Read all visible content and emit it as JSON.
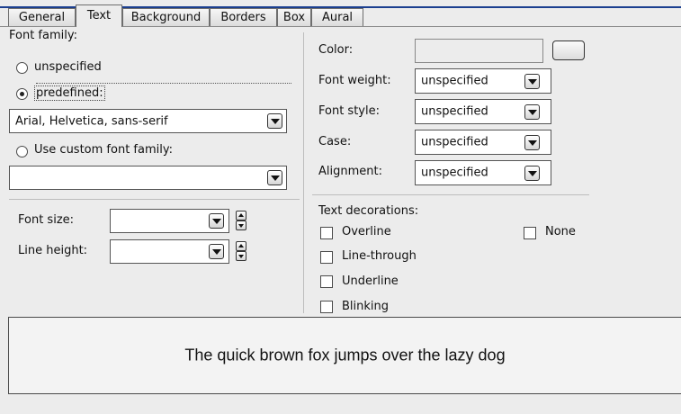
{
  "tabs": [
    {
      "label": "General"
    },
    {
      "label": "Text"
    },
    {
      "label": "Background"
    },
    {
      "label": "Borders"
    },
    {
      "label": "Box"
    },
    {
      "label": "Aural"
    }
  ],
  "active_tab": "Text",
  "font_family": {
    "section_label": "Font family:",
    "option_unspecified": "unspecified",
    "option_predefined": "predefined:",
    "predefined_value": "Arial, Helvetica, sans-serif",
    "option_custom": "Use custom font family:",
    "custom_value": "",
    "selected": "predefined"
  },
  "font_size": {
    "label": "Font size:",
    "value": ""
  },
  "line_height": {
    "label": "Line height:",
    "value": ""
  },
  "color": {
    "label": "Color:",
    "value": ""
  },
  "font_weight": {
    "label": "Font weight:",
    "value": "unspecified"
  },
  "font_style": {
    "label": "Font style:",
    "value": "unspecified"
  },
  "case": {
    "label": "Case:",
    "value": "unspecified"
  },
  "alignment": {
    "label": "Alignment:",
    "value": "unspecified"
  },
  "text_decorations": {
    "label": "Text decorations:",
    "overline": "Overline",
    "line_through": "Line-through",
    "underline": "Underline",
    "blinking": "Blinking",
    "none": "None"
  },
  "preview": {
    "text": "The quick brown fox jumps over the lazy dog"
  },
  "colors": {
    "accent_border": "#1b3f8f",
    "background": "#ececec",
    "field": "#ffffff"
  }
}
